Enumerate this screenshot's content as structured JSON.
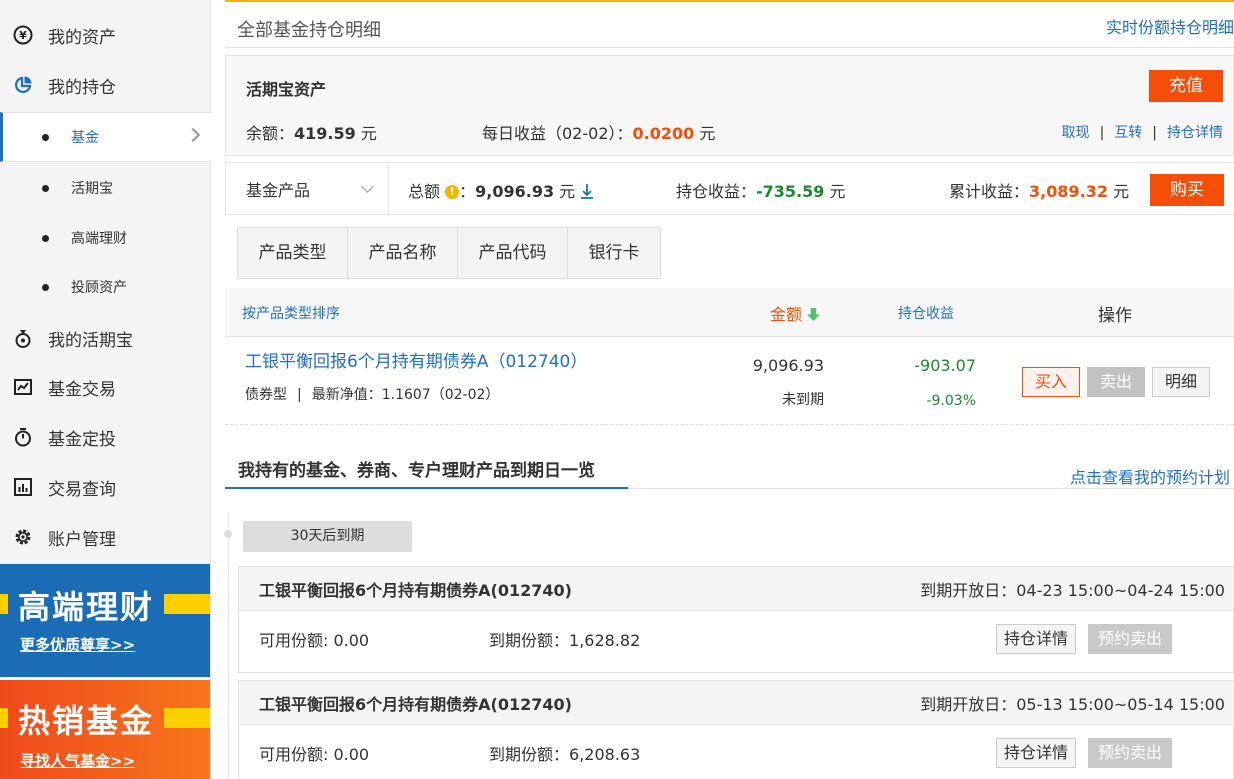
{
  "sidebar": {
    "items": [
      {
        "label": "我的资产",
        "icon": "yen-circle-icon"
      },
      {
        "label": "我的持仓",
        "icon": "pie-chart-icon"
      },
      {
        "label": "我的活期宝",
        "icon": "money-bag-icon"
      },
      {
        "label": "基金交易",
        "icon": "line-chart-icon"
      },
      {
        "label": "基金定投",
        "icon": "stopwatch-icon"
      },
      {
        "label": "交易查询",
        "icon": "bar-chart-icon"
      },
      {
        "label": "账户管理",
        "icon": "gear-icon"
      }
    ],
    "sub_items": [
      "基金",
      "活期宝",
      "高端理财",
      "投顾资产"
    ],
    "banner1": {
      "title": "高端理财",
      "link": "更多优质尊享>>"
    },
    "banner2": {
      "title": "热销基金",
      "link": "寻找人气基金>>"
    }
  },
  "header": {
    "title": "全部基金持仓明细",
    "link": "实时份额持仓明细"
  },
  "hqb": {
    "name": "活期宝资产",
    "charge_label": "充值",
    "balance_label": "余额：",
    "balance_value": "419.59",
    "balance_unit": "元",
    "daily_label": "每日收益（02-02）：",
    "daily_value": "0.0200",
    "daily_unit": "元",
    "ops": [
      "取现",
      "互转",
      "持仓详情"
    ],
    "ops_sep": "|"
  },
  "summary": {
    "product_select": "基金产品",
    "total_label": "总额",
    "info_glyph": "!",
    "colon": "：",
    "total_value": "9,096.93",
    "unit": "元",
    "hold_label": "持仓收益：",
    "hold_value": "-735.59",
    "cum_label": "累计收益：",
    "cum_value": "3,089.32",
    "buy_label": "购买"
  },
  "filters": [
    "产品类型",
    "产品名称",
    "产品代码",
    "银行卡"
  ],
  "table": {
    "sort_label": "按产品类型排序",
    "amount_label": "金额",
    "profit_label": "持仓收益",
    "ops_label": "操作"
  },
  "row": {
    "name": "工银平衡回报6个月持有期债券A（012740）",
    "type": "债券型",
    "sep": "|",
    "nav": "最新净值：1.1607（02-02）",
    "amount": "9,096.93",
    "status": "未到期",
    "profit": "-903.07",
    "profit_pct": "-9.03%",
    "buy": "买入",
    "sell": "卖出",
    "detail": "明细"
  },
  "maturity": {
    "tab": "我持有的基金、券商、专户理财产品到期日一览",
    "link": "点击查看我的预约计划",
    "badge": "30天后到期",
    "cards": [
      {
        "name": "工银平衡回报6个月持有期债券A(012740)",
        "date": "到期开放日：04-23 15:00~04-24 15:00",
        "available": "可用份额: 0.00",
        "due_label": "到期份额：",
        "due_value": "1,628.82",
        "btn1": "持仓详情",
        "btn2": "预约卖出"
      },
      {
        "name": "工银平衡回报6个月持有期债券A(012740)",
        "date": "到期开放日：05-13 15:00~05-14 15:00",
        "available": "可用份额: 0.00",
        "due_label": "到期份额：",
        "due_value": "6,208.63",
        "btn1": "持仓详情",
        "btn2": "预约卖出"
      }
    ]
  },
  "colors": {
    "accent": "#1f6fc5",
    "orange": "#f44e09",
    "green": "#1a8a2a",
    "top_line": "#f0b400"
  }
}
